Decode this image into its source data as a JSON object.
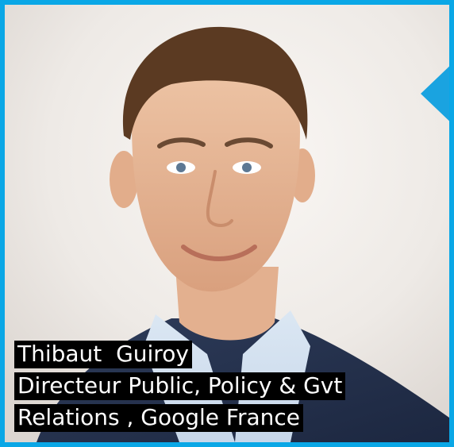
{
  "frame": {
    "border_color": "#0aa7e6",
    "accent_color": "#1aa3e0"
  },
  "photo": {
    "subject": "portrait",
    "icon": "person-photo"
  },
  "caption": {
    "name": "Thibaut  Guiroy",
    "title_line1": "Directeur Public, Policy & Gvt",
    "title_line2": "Relations , Google France"
  }
}
